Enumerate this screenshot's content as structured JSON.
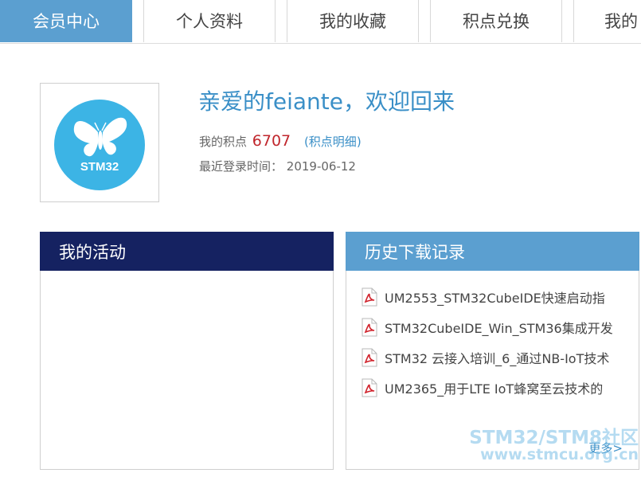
{
  "tabs": [
    {
      "label": "会员中心",
      "active": true
    },
    {
      "label": "个人资料",
      "active": false
    },
    {
      "label": "我的收藏",
      "active": false
    },
    {
      "label": "积点兑换",
      "active": false
    },
    {
      "label": "我的",
      "active": false
    }
  ],
  "profile": {
    "avatar_text": "STM32",
    "welcome": "亲爱的feiante，欢迎回来",
    "points_label": "我的积点",
    "points_value": "6707",
    "points_link_open": "(",
    "points_link": "积点明细",
    "points_link_close": ")",
    "last_login_label": "最近登录时间：",
    "last_login_date": "2019-06-12"
  },
  "activity": {
    "title": "我的活动"
  },
  "history": {
    "title": "历史下载记录",
    "items": [
      "UM2553_STM32CubeIDE快速启动指",
      "STM32CubeIDE_Win_STM36集成开发",
      "STM32 云接入培训_6_通过NB-IoT技术",
      "UM2365_用于LTE IoT蜂窝至云技术的"
    ],
    "more": "更多>"
  },
  "watermark": {
    "line1": "STM32/STM8社区",
    "line2": "www.stmcu.org.cn"
  },
  "colors": {
    "tab_active": "#5b9fd0",
    "activity_header": "#152261",
    "history_header": "#5b9fd0",
    "link": "#3a8fc7",
    "points": "#c0262c",
    "logo_circle": "#3cb4e5"
  }
}
